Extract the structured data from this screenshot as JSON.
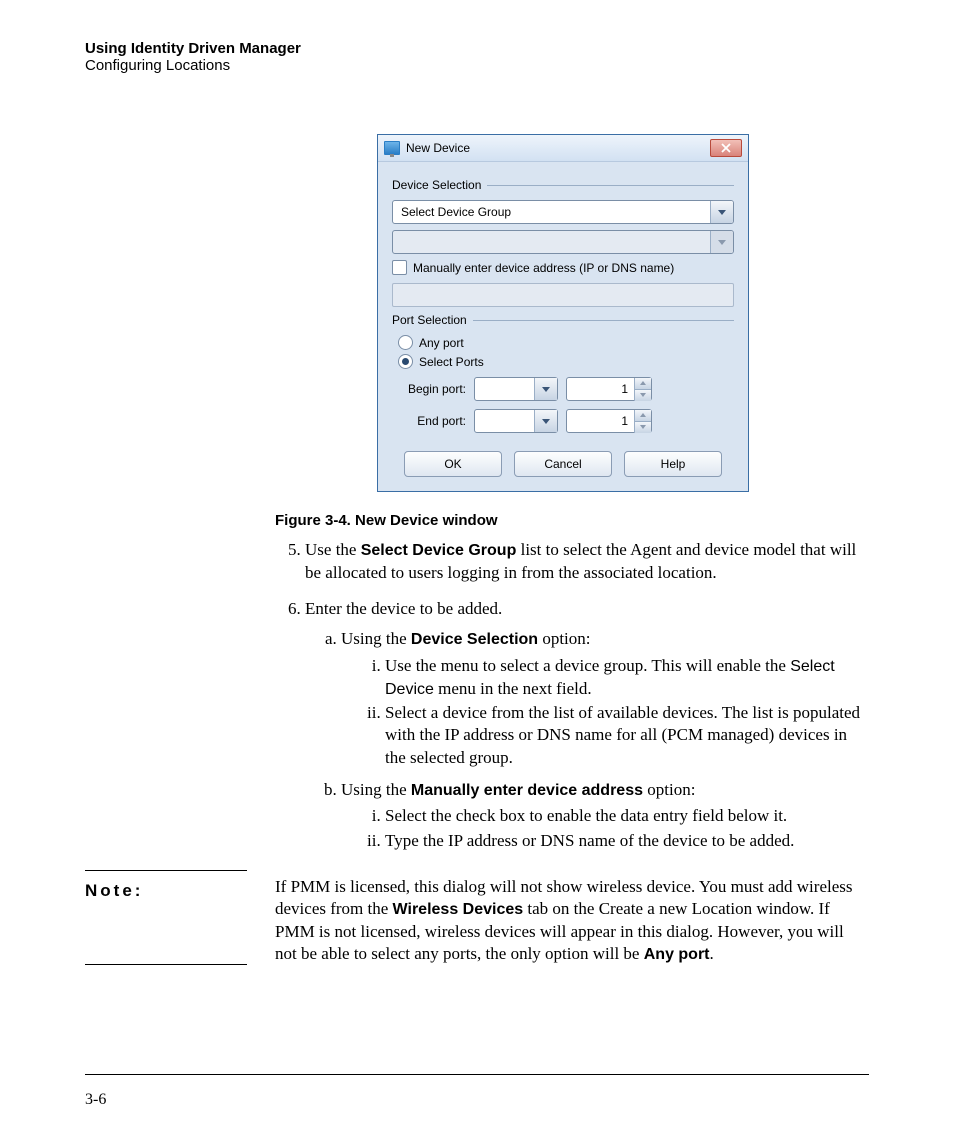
{
  "header": {
    "line1": "Using Identity Driven Manager",
    "line2": "Configuring Locations"
  },
  "dialog": {
    "title": "New Device",
    "device_section_label": "Device Selection",
    "device_group_select": "Select Device Group",
    "manual_checkbox_label": "Manually enter device address (IP or DNS name)",
    "port_section_label": "Port Selection",
    "radio_any": "Any port",
    "radio_select": "Select Ports",
    "begin_port_label": "Begin port:",
    "end_port_label": "End port:",
    "begin_port_value": "1",
    "end_port_value": "1",
    "btn_ok": "OK",
    "btn_cancel": "Cancel",
    "btn_help": "Help"
  },
  "caption": "Figure 3-4. New Device window",
  "steps": {
    "s5_pre": "Use the ",
    "s5_bold": "Select Device Group",
    "s5_post": " list to select the Agent and device model that will be allocated to users logging in from the associated location.",
    "s6": "Enter the device to be added.",
    "a_pre": "Using the ",
    "a_bold": "Device Selection",
    "a_post": " option:",
    "a_i_pre": "Use the menu to select a device group. This will enable the ",
    "a_i_helv": "Select Device",
    "a_i_post": " menu in the next field.",
    "a_ii": "Select a device from the list of available devices. The list is populated with the IP address or DNS name for all (PCM managed) devices in the selected group.",
    "b_pre": "Using the ",
    "b_bold": "Manually enter device address",
    "b_post": " option:",
    "b_i": "Select the check box to enable the data entry field below it.",
    "b_ii": "Type the IP address or DNS name of the device to be added."
  },
  "note": {
    "label": "Note:",
    "t1": "If PMM is licensed, this dialog will not show wireless device. You must add wireless devices from the ",
    "b1": "Wireless Devices",
    "t2": " tab on the Create a new Location window. If PMM is not licensed, wireless devices will appear in this dialog. However, you will not be able to select any ports, the only option will be ",
    "b2": "Any port",
    "t3": "."
  },
  "page_number": "3-6"
}
